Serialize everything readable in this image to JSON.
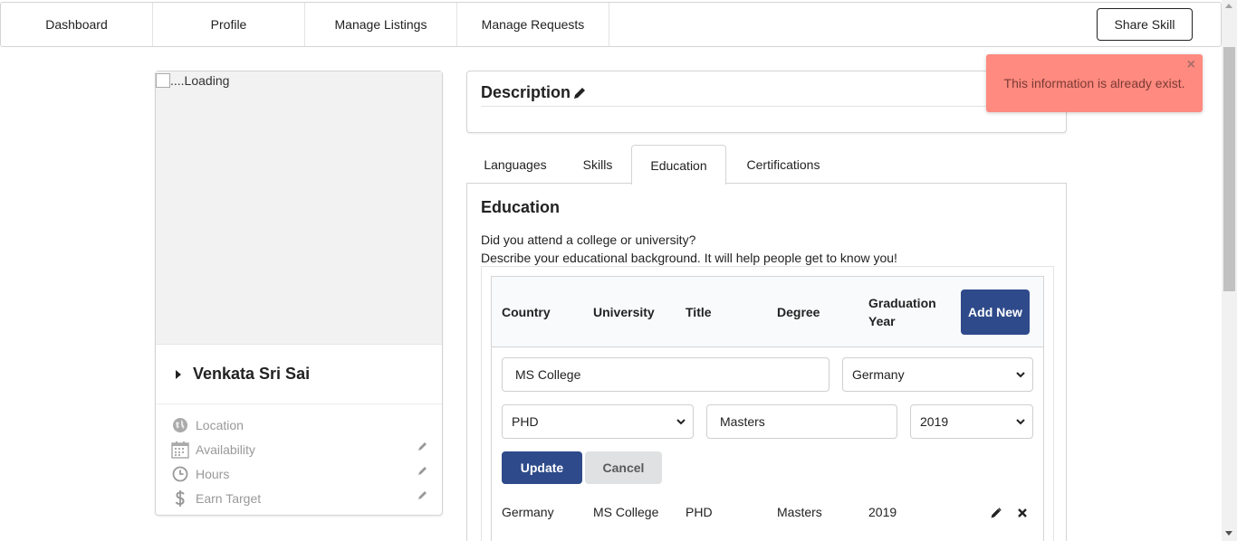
{
  "nav": {
    "items": [
      "Dashboard",
      "Profile",
      "Manage Listings",
      "Manage Requests"
    ],
    "share_label": "Share Skill"
  },
  "profile": {
    "image_alt": "....Loading",
    "name": "Venkata Sri Sai",
    "info": [
      {
        "label": "Location",
        "icon": "globe-icon",
        "editable": false
      },
      {
        "label": "Availability",
        "icon": "calendar-icon",
        "editable": true
      },
      {
        "label": "Hours",
        "icon": "clock-icon",
        "editable": true
      },
      {
        "label": "Earn Target",
        "icon": "dollar-icon",
        "editable": true
      }
    ]
  },
  "description": {
    "title": "Description"
  },
  "toast": {
    "message": "This information is already exist.",
    "close": "×"
  },
  "tabs": [
    "Languages",
    "Skills",
    "Education",
    "Certifications"
  ],
  "active_tab": "Education",
  "education": {
    "title": "Education",
    "question": "Did you attend a college or university?",
    "hint": "Describe your educational background. It will help people get to know you!",
    "headers": [
      "Country",
      "University",
      "Title",
      "Degree",
      "Graduation Year"
    ],
    "add_label": "Add New",
    "form": {
      "university": "MS College",
      "country": "Germany",
      "title": "PHD",
      "degree": "Masters",
      "year": "2019",
      "update_label": "Update",
      "cancel_label": "Cancel"
    },
    "rows": [
      {
        "country": "Germany",
        "university": "MS College",
        "title": "PHD",
        "degree": "Masters",
        "year": "2019"
      }
    ]
  },
  "colors": {
    "primary": "#2e4a8a",
    "toast_bg": "#ff8a7f",
    "cancel_bg": "#e0e1e2"
  }
}
